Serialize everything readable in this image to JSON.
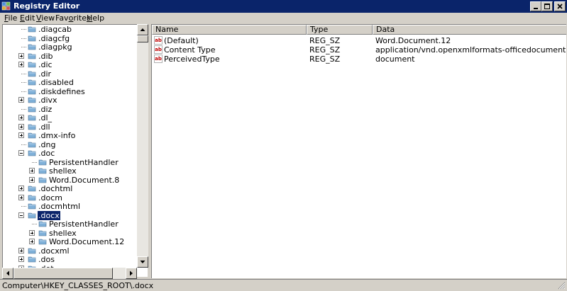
{
  "window": {
    "title": "Registry Editor"
  },
  "menu": [
    {
      "accel": "F",
      "rest": "ile"
    },
    {
      "accel": "E",
      "rest": "dit"
    },
    {
      "accel": "V",
      "rest": "iew"
    },
    {
      "accel": "",
      "rest": "Fav",
      "accel2": "o",
      "rest2": "rites"
    },
    {
      "accel": "H",
      "rest": "elp"
    }
  ],
  "tree": {
    "items": [
      {
        "label": ".diagcab",
        "indent": 1,
        "expandable": false
      },
      {
        "label": ".diagcfg",
        "indent": 1,
        "expandable": false
      },
      {
        "label": ".diagpkg",
        "indent": 1,
        "expandable": false
      },
      {
        "label": ".dib",
        "indent": 1,
        "expandable": true,
        "expanded": false
      },
      {
        "label": ".dic",
        "indent": 1,
        "expandable": true,
        "expanded": false
      },
      {
        "label": ".dir",
        "indent": 1,
        "expandable": false
      },
      {
        "label": ".disabled",
        "indent": 1,
        "expandable": false
      },
      {
        "label": ".diskdefines",
        "indent": 1,
        "expandable": false
      },
      {
        "label": ".divx",
        "indent": 1,
        "expandable": true,
        "expanded": false
      },
      {
        "label": ".diz",
        "indent": 1,
        "expandable": false
      },
      {
        "label": ".dl_",
        "indent": 1,
        "expandable": true,
        "expanded": false
      },
      {
        "label": ".dll",
        "indent": 1,
        "expandable": true,
        "expanded": false
      },
      {
        "label": ".dmx-info",
        "indent": 1,
        "expandable": true,
        "expanded": false
      },
      {
        "label": ".dng",
        "indent": 1,
        "expandable": false
      },
      {
        "label": ".doc",
        "indent": 1,
        "expandable": true,
        "expanded": true
      },
      {
        "label": "PersistentHandler",
        "indent": 2,
        "expandable": false
      },
      {
        "label": "shellex",
        "indent": 2,
        "expandable": true,
        "expanded": false
      },
      {
        "label": "Word.Document.8",
        "indent": 2,
        "expandable": true,
        "expanded": false
      },
      {
        "label": ".dochtml",
        "indent": 1,
        "expandable": true,
        "expanded": false
      },
      {
        "label": ".docm",
        "indent": 1,
        "expandable": true,
        "expanded": false
      },
      {
        "label": ".docmhtml",
        "indent": 1,
        "expandable": false
      },
      {
        "label": ".docx",
        "indent": 1,
        "expandable": true,
        "expanded": true,
        "selected": true
      },
      {
        "label": "PersistentHandler",
        "indent": 2,
        "expandable": false
      },
      {
        "label": "shellex",
        "indent": 2,
        "expandable": true,
        "expanded": false
      },
      {
        "label": "Word.Document.12",
        "indent": 2,
        "expandable": true,
        "expanded": false
      },
      {
        "label": ".docxml",
        "indent": 1,
        "expandable": true,
        "expanded": false
      },
      {
        "label": ".dos",
        "indent": 1,
        "expandable": true,
        "expanded": false
      },
      {
        "label": ".dot",
        "indent": 1,
        "expandable": true,
        "expanded": false
      }
    ]
  },
  "list": {
    "columns": [
      "Name",
      "Type",
      "Data"
    ],
    "rows": [
      {
        "name": "(Default)",
        "type": "REG_SZ",
        "data": "Word.Document.12"
      },
      {
        "name": "Content Type",
        "type": "REG_SZ",
        "data": "application/vnd.openxmlformats-officedocument.word..."
      },
      {
        "name": "PerceivedType",
        "type": "REG_SZ",
        "data": "document"
      }
    ],
    "value_icon_text": "ab"
  },
  "status": {
    "path": "Computer\\HKEY_CLASSES_ROOT\\.docx"
  },
  "colors": {
    "titlebar": "#0a246a",
    "selection": "#0a246a",
    "folder": "#7fb0d8"
  }
}
